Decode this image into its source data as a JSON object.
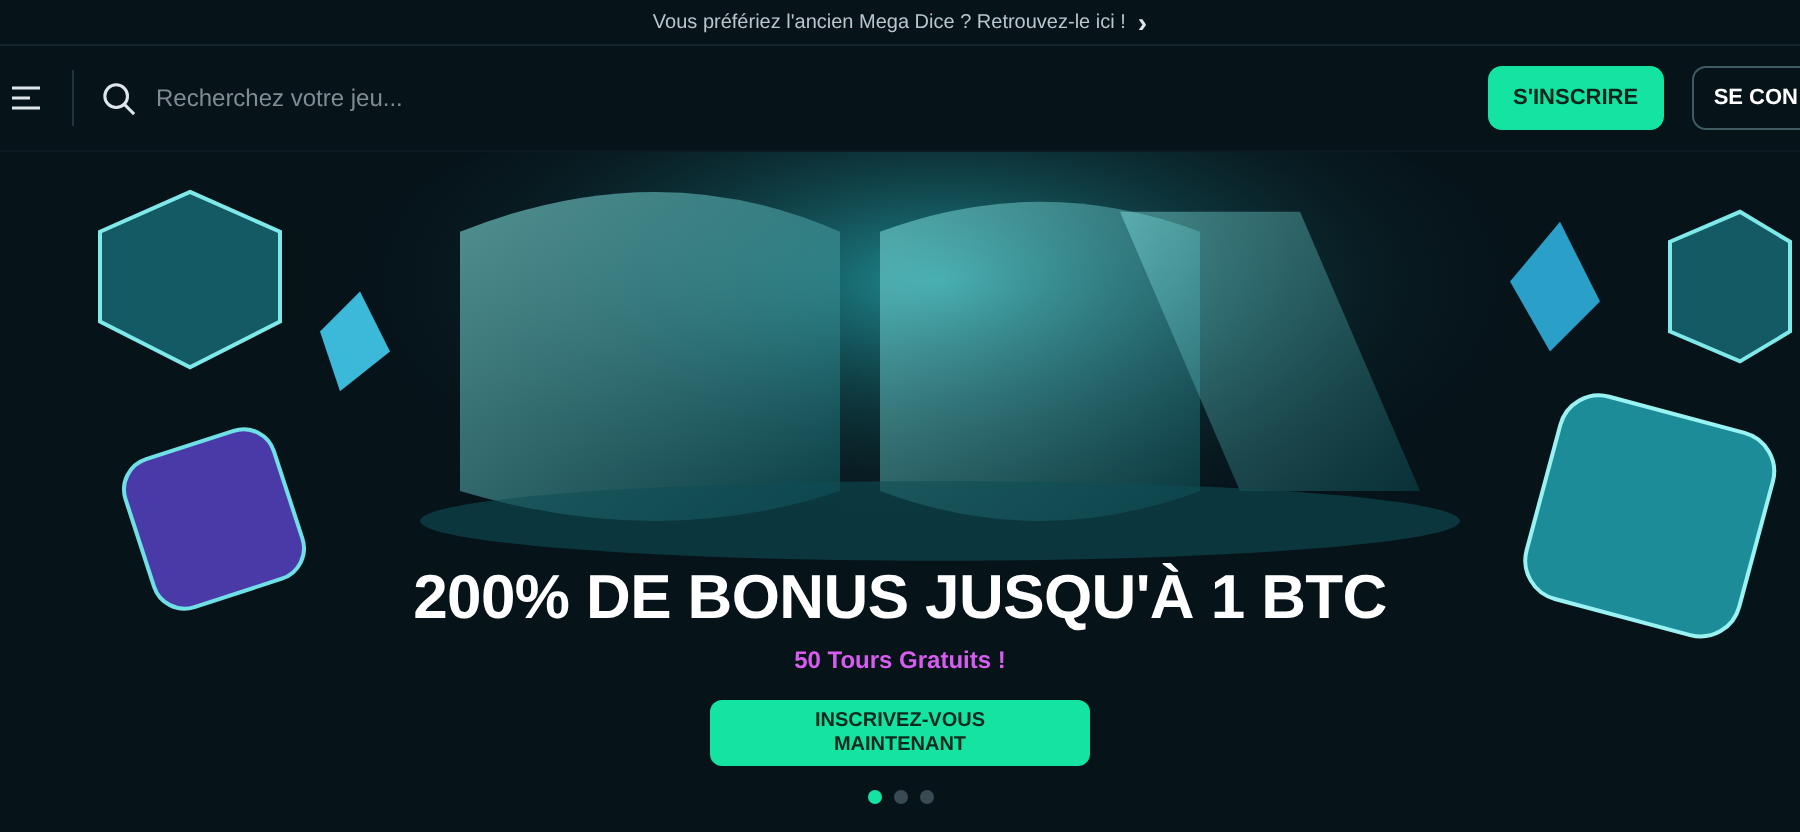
{
  "announcement": {
    "text": "Vous préfériez l'ancien Mega Dice ? Retrouvez-le ici !",
    "arrow": "›"
  },
  "header": {
    "search": {
      "placeholder": "Recherchez votre jeu..."
    },
    "buttons": [
      {
        "label": "S'INSCRIRE",
        "kind": "primary"
      },
      {
        "label": "SE CON",
        "kind": "outline"
      }
    ]
  },
  "banner": {
    "kind": "picture",
    "title": "200% DE BONUS JUSQU'À 1 BTC",
    "subtitle": "50 Tours Gratuits !",
    "cta": "INSCRIVEZ-VOUS MAINTENANT",
    "slides": [
      {
        "selected": true
      },
      {
        "selected": false
      },
      {
        "selected": false
      }
    ]
  }
}
